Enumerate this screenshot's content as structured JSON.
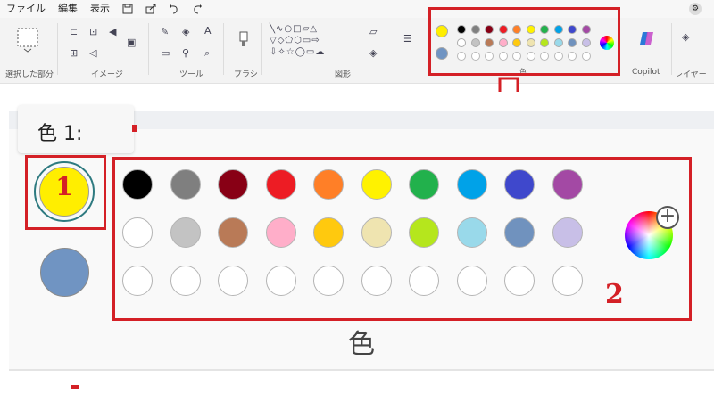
{
  "menubar": {
    "items": [
      "ファイル",
      "編集",
      "表示"
    ],
    "icons": [
      "save-icon",
      "share-icon",
      "undo-icon",
      "redo-icon"
    ]
  },
  "ribbon": {
    "groups": [
      "選択した部分",
      "イメージ",
      "ツール",
      "ブラシ",
      "図形",
      "色",
      "Copilot",
      "レイヤー"
    ]
  },
  "colors": {
    "primary_label": "色 1:",
    "primary_color": "#ffee00",
    "secondary_color": "#7094c2",
    "row1": [
      "#000000",
      "#7f7f7f",
      "#880015",
      "#ed1c24",
      "#ff7f27",
      "#fff200",
      "#22b14c",
      "#00a2e8",
      "#3f48cc",
      "#a349a4"
    ],
    "row2": [
      "#ffffff",
      "#c3c3c3",
      "#b97a57",
      "#ffaec9",
      "#ffc90e",
      "#efe4b0",
      "#b5e61d",
      "#99d9ea",
      "#7092be",
      "#c8bfe7"
    ],
    "row3_count": 10,
    "group_label": "色"
  },
  "annotations": {
    "marker1": "1",
    "marker2": "2",
    "box_color": "#d42026",
    "arrow_color": "#d42026"
  }
}
